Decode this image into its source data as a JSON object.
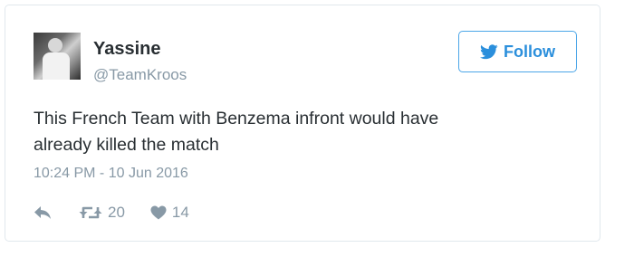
{
  "author": {
    "display_name": "Yassine",
    "handle": "@TeamKroos"
  },
  "follow_button": {
    "label": "Follow",
    "icon": "twitter-bird-icon",
    "color": "#2b8fdc"
  },
  "tweet": {
    "text": "This French Team with Benzema infront would have\nalready killed the match",
    "timestamp": "10:24 PM - 10 Jun 2016"
  },
  "actions": {
    "reply": {
      "icon": "reply-icon"
    },
    "retweet": {
      "icon": "retweet-icon",
      "count": "20"
    },
    "like": {
      "icon": "heart-icon",
      "count": "14"
    }
  },
  "colors": {
    "text": "#292f33",
    "muted": "#8899a6",
    "accent": "#2b8fdc",
    "border": "#e1e8ed"
  }
}
